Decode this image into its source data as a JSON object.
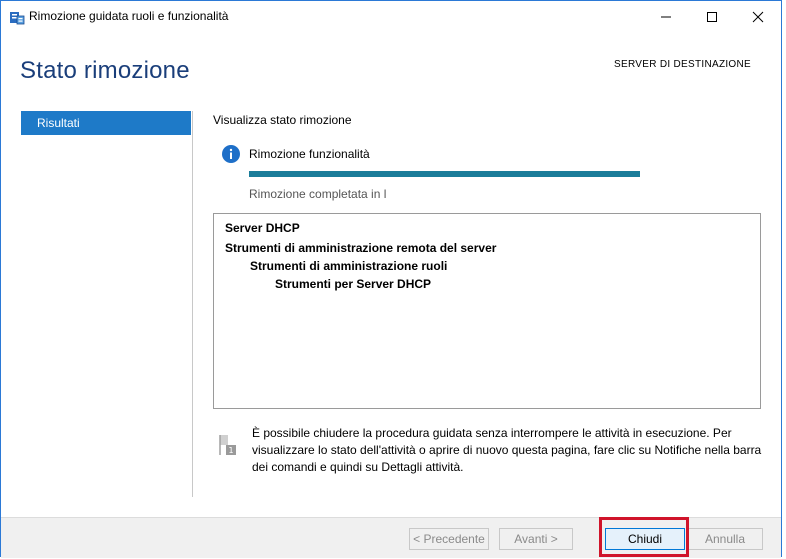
{
  "window": {
    "title": "Rimozione guidata ruoli e funzionalità",
    "minimize_glyph": "—",
    "maximize_glyph": "☐",
    "close_glyph": "✕"
  },
  "header": {
    "page_title": "Stato rimozione",
    "destination_label": "SERVER DI DESTINAZIONE"
  },
  "nav": {
    "items": [
      {
        "label": "Risultati",
        "selected": true
      }
    ]
  },
  "main": {
    "section_label": "Visualizza stato rimozione",
    "status_title": "Rimozione funzionalità",
    "progress": 1.0,
    "complete_text": "Rimozione completata in l",
    "results": [
      "Server DHCP",
      "Strumenti di amministrazione remota del server",
      "Strumenti di amministrazione ruoli",
      "Strumenti per Server DHCP"
    ],
    "note": "È possibile chiudere la procedura guidata senza interrompere le attività in esecuzione. Per visualizzare lo stato dell'attività o aprire di nuovo questa pagina, fare clic su Notifiche nella barra dei comandi e quindi su Dettagli attività."
  },
  "footer": {
    "prev_label": "< Precedente",
    "next_label": "Avanti >",
    "close_label": "Chiudi",
    "cancel_label": "Annulla"
  },
  "colors": {
    "accent": "#1e7ac8",
    "title": "#1a3e7a",
    "progress": "#1b7d9a",
    "highlight": "#d0142a"
  },
  "icons": {
    "app": "server-manager-icon",
    "info": "info-icon",
    "note": "flag-icon"
  }
}
